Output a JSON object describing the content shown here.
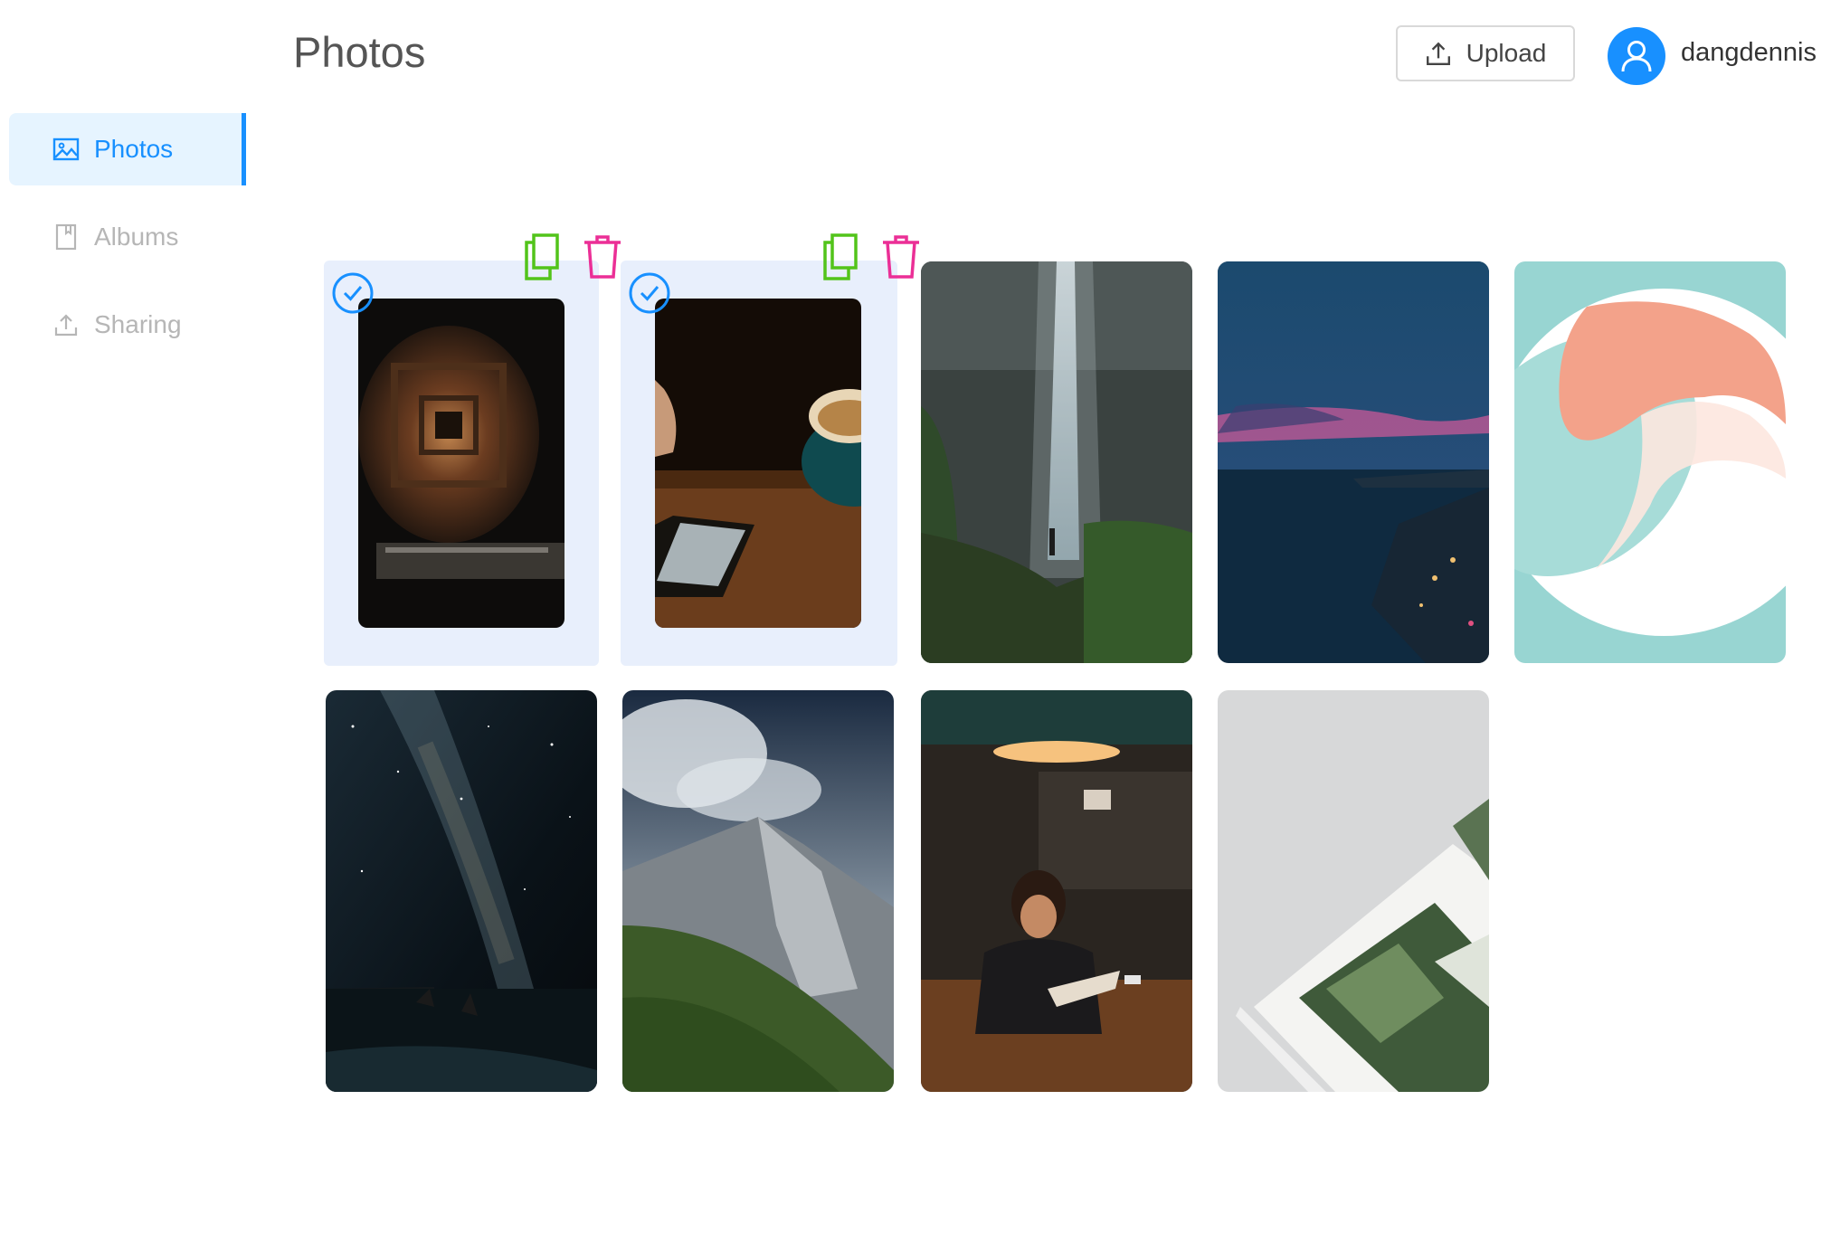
{
  "page": {
    "title": "Photos"
  },
  "sidebar": {
    "items": [
      {
        "label": "Photos",
        "icon": "image-icon",
        "active": true
      },
      {
        "label": "Albums",
        "icon": "book-icon",
        "active": false
      },
      {
        "label": "Sharing",
        "icon": "upload-icon",
        "active": false
      }
    ]
  },
  "header": {
    "upload_label": "Upload",
    "user": {
      "name": "dangdennis",
      "icon": "user-icon"
    }
  },
  "colors": {
    "accent": "#1890ff",
    "selected_bg": "#e8effc",
    "copy": "#52c41a",
    "delete": "#eb2f96"
  },
  "photos": [
    {
      "subject": "spiral staircase",
      "selected": true
    },
    {
      "subject": "phone and coffee",
      "selected": true
    },
    {
      "subject": "waterfall",
      "selected": false
    },
    {
      "subject": "coastal city at dusk",
      "selected": false
    },
    {
      "subject": "abstract logo",
      "selected": false
    },
    {
      "subject": "milky way over sea",
      "selected": false
    },
    {
      "subject": "mountain peak",
      "selected": false
    },
    {
      "subject": "woman reading in cafe",
      "selected": false
    },
    {
      "subject": "open magazine",
      "selected": false
    }
  ]
}
